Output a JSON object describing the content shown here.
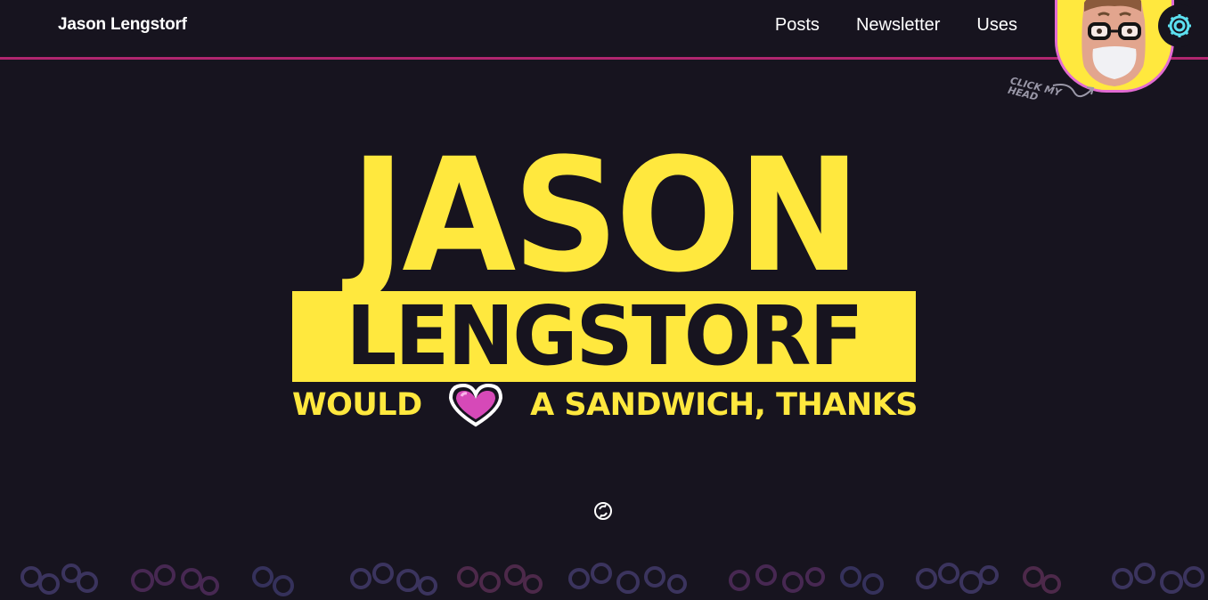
{
  "header": {
    "site_title": "Jason Lengstorf",
    "nav": [
      {
        "label": "Posts"
      },
      {
        "label": "Newsletter"
      },
      {
        "label": "Uses"
      }
    ],
    "avatar_hint": "CLICK MY HEAD",
    "settings_icon": "gear-icon"
  },
  "hero": {
    "first_name": "JASON",
    "last_name": "LENGSTORF",
    "tagline_before": "WOULD",
    "tagline_icon": "heart-icon",
    "tagline_after": "A SANDWICH, THANKS",
    "refresh_icon": "refresh-icon"
  },
  "colors": {
    "background": "#17141f",
    "accent_yellow": "#ffe83e",
    "accent_pink": "#e26bd2",
    "divider": "#b0266f"
  }
}
